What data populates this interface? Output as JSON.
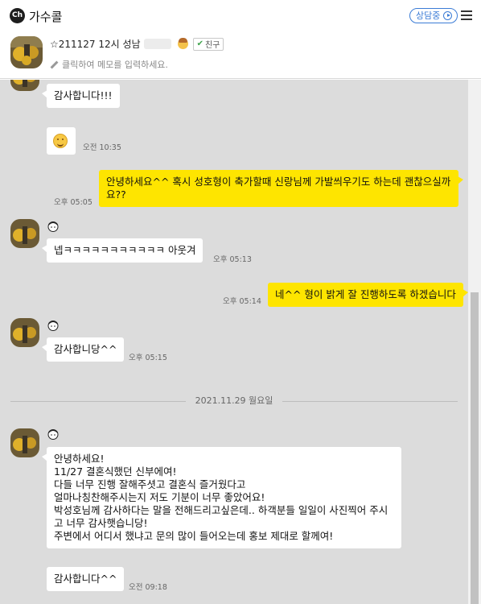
{
  "header": {
    "channel_badge": "Ch",
    "app_title": "가수콜",
    "status_label": "상담중"
  },
  "profile": {
    "name": "☆211127 12시 성남",
    "friend_label": "친구",
    "memo_placeholder": "클릭하여 메모를 입력하세요."
  },
  "colors": {
    "accent_blue": "#3b7cd6",
    "my_bubble": "#fee500",
    "chat_bg": "#dcdcdc"
  },
  "messages": {
    "m1": {
      "text": "감사합니다!!!"
    },
    "m2": {
      "sticker": "smile-emoji",
      "time": "오전 10:35"
    },
    "m3": {
      "text": "안녕하세요^^ 혹시 성호형이 축가할때 신랑님께 가발씌우기도 하는데 괜찮으실까\n요??",
      "time": "오후 05:05"
    },
    "m4": {
      "text": "넵ㅋㅋㅋㅋㅋㅋㅋㅋㅋㅋㅋ 아웃겨",
      "time": "오후 05:13"
    },
    "m5": {
      "text": "네^^ 형이 밝게 잘 진행하도록 하겠습니다",
      "time": "오후 05:14"
    },
    "m6": {
      "text": "감사합니당^^",
      "time": "오후 05:15"
    },
    "date_divider": "2021.11.29 월요일",
    "m7": {
      "text": "안녕하세요!\n11/27 결혼식했던 신부에여!\n다들 너무 진행 잘해주셧고 결혼식 즐거웠다고\n얼마나칭찬해주시는지 저도 기분이 너무 좋았어요!\n박성호님께 감사하다는 말을 전해드리고싶은데.. 하객분들 일일이 사진찍어 주시\n고 너무 감사햇습니당!\n주변에서 어디서 했냐고 문의 많이 들어오는데 홍보 제대로 할께여!"
    },
    "m8": {
      "text": "감사합니다^^",
      "time": "오전 09:18"
    }
  }
}
